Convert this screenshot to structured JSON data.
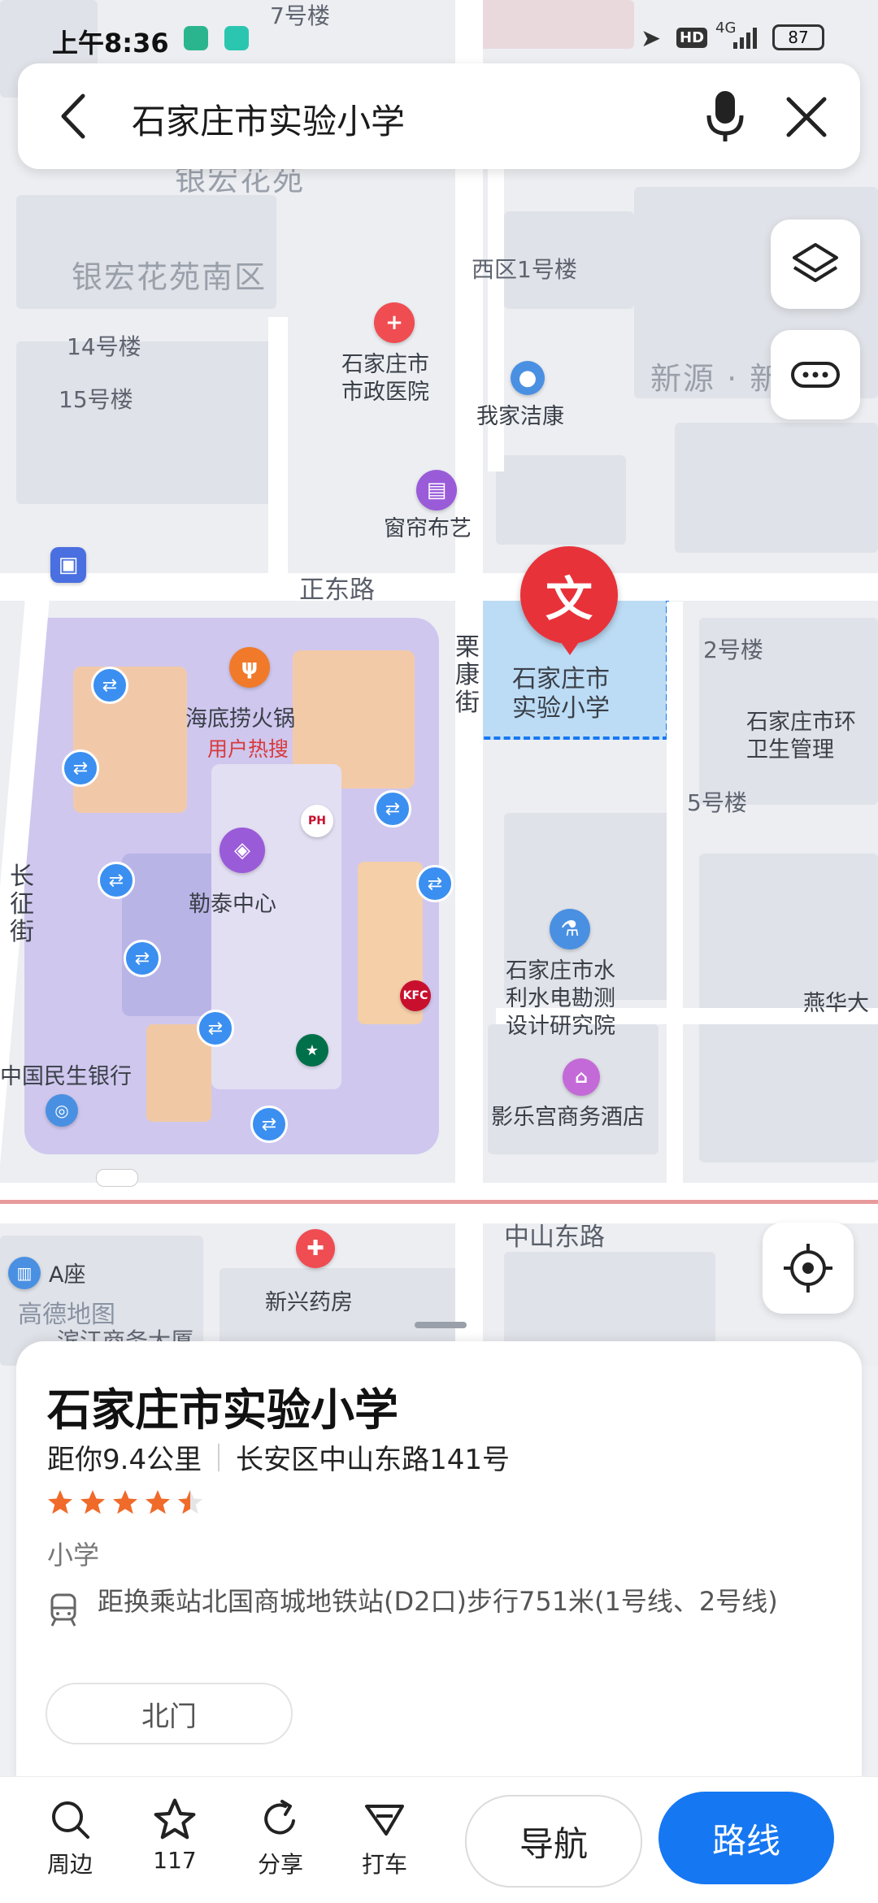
{
  "status_bar": {
    "time": "上午8:36",
    "battery": "87",
    "network": "4G",
    "hd": "HD"
  },
  "search": {
    "query": "石家庄市实验小学"
  },
  "map": {
    "labels": {
      "building_7": "7号楼",
      "yinhong_garden": "银宏花苑",
      "yinhong_south": "银宏花苑南区",
      "west_1": "西区1号楼",
      "b14": "14号楼",
      "b15": "15号楼",
      "xinyuan": "新源 · 新",
      "hospital": "石家庄市\n市政医院",
      "jiekang": "我家洁康",
      "curtain": "窗帘布艺",
      "zhengdong_road": "正东路",
      "school_poi": "石家庄市\n实验小学",
      "su_kang_street": "栗\n康\n街",
      "b2": "2号楼",
      "env_sanitation": "石家庄市环\n卫生管理",
      "b5": "5号楼",
      "haidilao": "海底捞火锅",
      "hot_search": "用户热搜",
      "letai": "勒泰中心",
      "changzheng_street": "长\n征\n街",
      "water_institute": "石家庄市水\n利水电勘测\n设计研究院",
      "yanhua": "燕华大",
      "minsheng_bank": "中国民生银行",
      "yingle_hotel": "影乐宫商务酒店",
      "zhongshan_road": "中山东路",
      "a_zuo": "A座",
      "amap": "高德地图",
      "xinxing_pharmacy": "新兴药房",
      "bottom_hint": "滨江商务大厦"
    }
  },
  "poi": {
    "name": "石家庄市实验小学",
    "distance": "距你9.4公里",
    "address": "长安区中山东路141号",
    "rating": 4.5,
    "category": "小学",
    "transit": "距换乘站北国商城地铁站(D2口)步行751米(1号线、2号线)",
    "entrance": "北门"
  },
  "bottom_bar": {
    "nearby": "周边",
    "favorites": "117",
    "share": "分享",
    "taxi": "打车",
    "navigate": "导航",
    "route": "路线"
  },
  "colors": {
    "accent": "#1677f2",
    "pin_red": "#e8323a",
    "star": "#f06a2a"
  }
}
